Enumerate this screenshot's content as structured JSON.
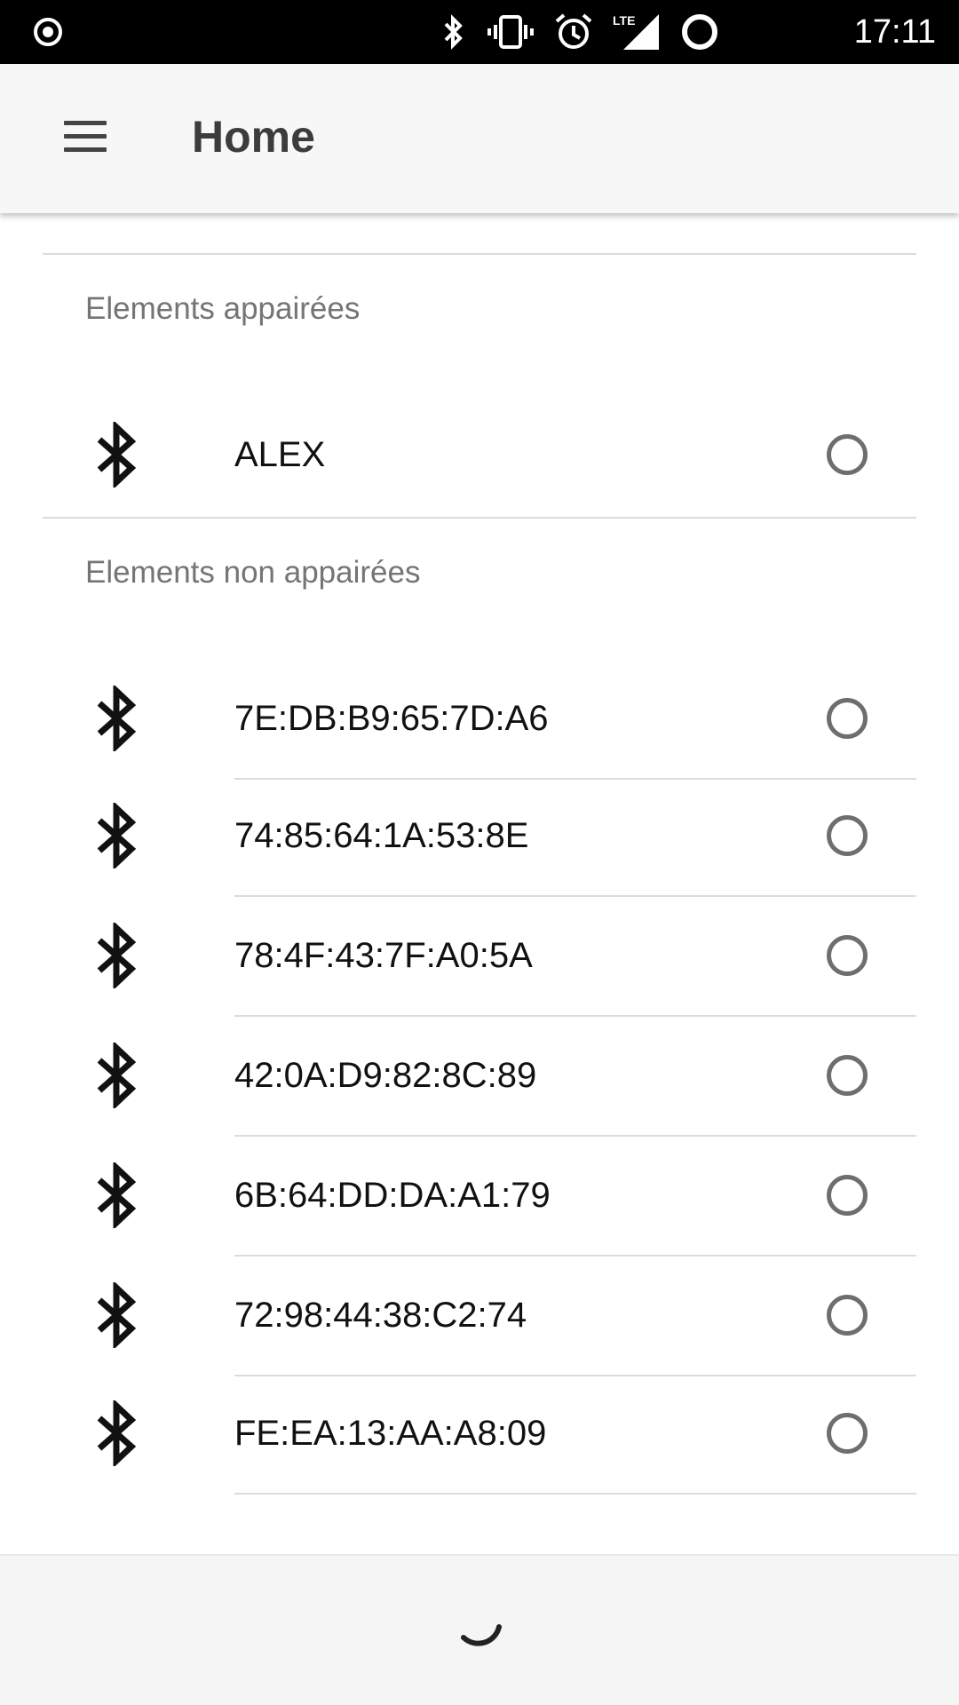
{
  "status_bar": {
    "time": "17:11",
    "left_icon": "cast-recording-icon",
    "icons": [
      "bluetooth-icon",
      "vibrate-icon",
      "alarm-icon",
      "lte-signal-icon",
      "battery-ring-icon"
    ],
    "network_label": "LTE"
  },
  "app_bar": {
    "title": "Home",
    "menu_icon": "hamburger-menu-icon"
  },
  "paired_section": {
    "header": "Elements appairées",
    "devices": [
      {
        "name": "ALEX",
        "icon": "bluetooth-icon",
        "selected": false
      }
    ]
  },
  "unpaired_section": {
    "header": "Elements non appairées",
    "devices": [
      {
        "name": "7E:DB:B9:65:7D:A6",
        "icon": "bluetooth-icon",
        "selected": false
      },
      {
        "name": "74:85:64:1A:53:8E",
        "icon": "bluetooth-icon",
        "selected": false
      },
      {
        "name": "78:4F:43:7F:A0:5A",
        "icon": "bluetooth-icon",
        "selected": false
      },
      {
        "name": "42:0A:D9:82:8C:89",
        "icon": "bluetooth-icon",
        "selected": false
      },
      {
        "name": "6B:64:DD:DA:A1:79",
        "icon": "bluetooth-icon",
        "selected": false
      },
      {
        "name": "72:98:44:38:C2:74",
        "icon": "bluetooth-icon",
        "selected": false
      },
      {
        "name": "FE:EA:13:AA:A8:09",
        "icon": "bluetooth-icon",
        "selected": false
      }
    ]
  },
  "loading": {
    "icon": "loading-spinner-icon"
  },
  "colors": {
    "status_bar": "#000000",
    "app_bar": "#f7f7f7",
    "divider": "#dcdcdc",
    "section_header_text": "#757575",
    "radio": "#6e6e6e"
  }
}
